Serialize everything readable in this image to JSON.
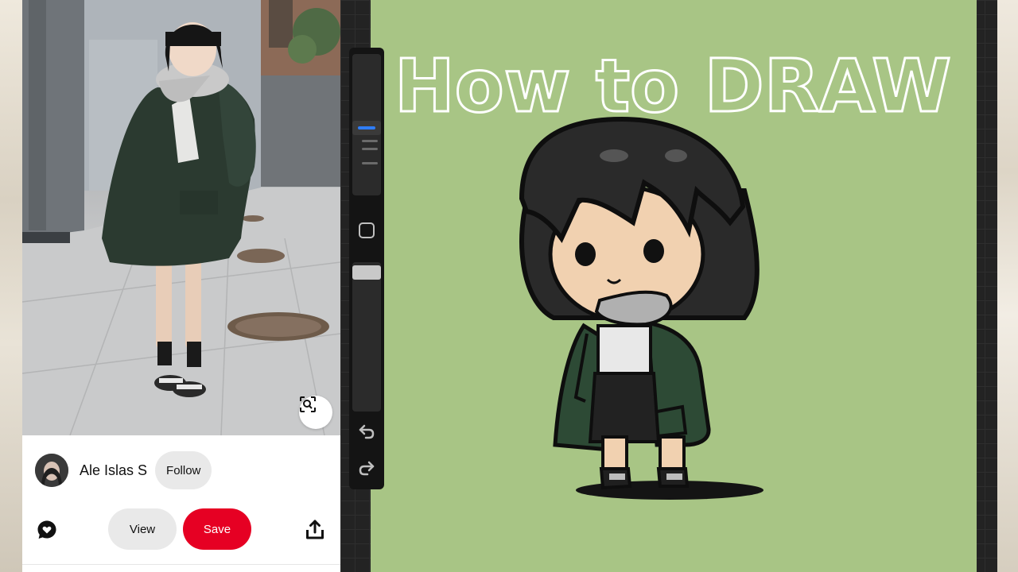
{
  "pin": {
    "author_name": "Ale Islas S",
    "follow_label": "Follow",
    "view_label": "View",
    "save_label": "Save",
    "icons": [
      "visual-search-icon",
      "comment-heart-icon",
      "share-icon"
    ],
    "colors": {
      "save": "#e60023",
      "pill": "#e9e9e9"
    }
  },
  "canvas": {
    "title_text": "How to DRAW",
    "background_color": "#a8c585",
    "toolbar_icons": [
      "modify-square-icon",
      "undo-icon",
      "redo-icon"
    ],
    "accent_color": "#2f7df6"
  }
}
